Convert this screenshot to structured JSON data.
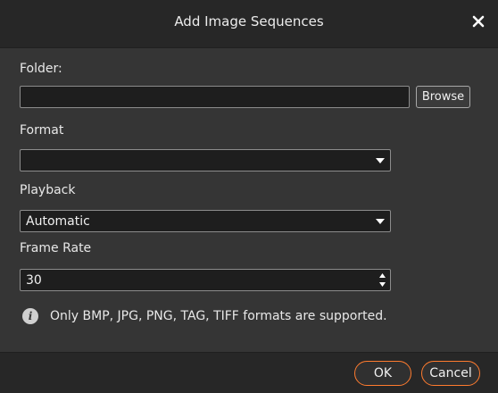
{
  "dialog": {
    "title": "Add Image Sequences",
    "close_glyph": "✕"
  },
  "folder": {
    "label": "Folder:",
    "value": "",
    "browse_label": "Browse"
  },
  "format": {
    "label": "Format",
    "selected": ""
  },
  "playback": {
    "label": "Playback",
    "selected": "Automatic"
  },
  "frame_rate": {
    "label": "Frame Rate",
    "value": "30"
  },
  "info": {
    "icon": "info-icon",
    "glyph": "i",
    "text": "Only BMP, JPG, PNG, TAG, TIFF formats are supported."
  },
  "footer": {
    "ok_label": "OK",
    "cancel_label": "Cancel"
  },
  "colors": {
    "accent": "#ff7b2e",
    "background": "#353535",
    "titlebar": "#272727",
    "field": "#1e1e1e"
  }
}
